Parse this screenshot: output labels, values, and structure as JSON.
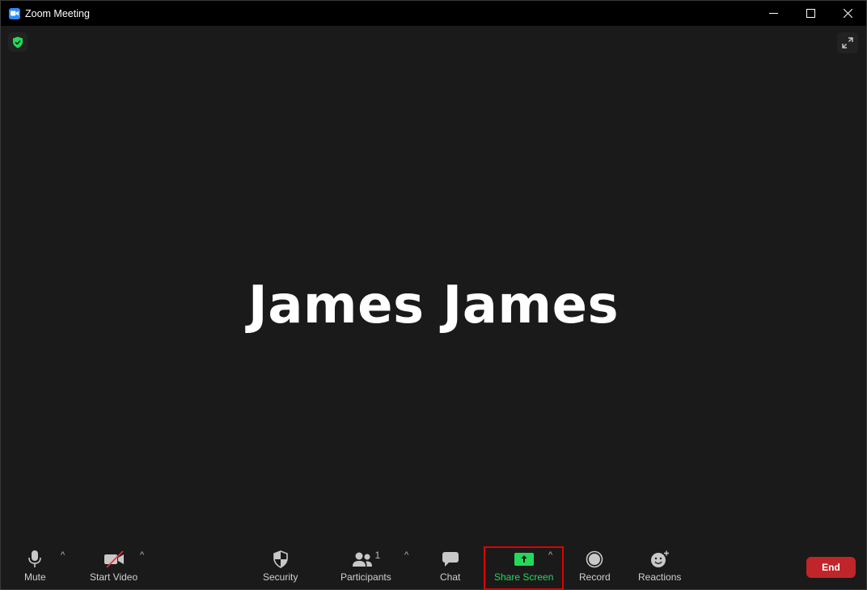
{
  "window": {
    "title": "Zoom Meeting",
    "app_icon": "zoom-camera-icon",
    "controls": [
      "minimize-icon",
      "maximize-icon",
      "close-icon"
    ]
  },
  "meeting": {
    "participant_name": "James James",
    "encryption_icon": "shield-check-icon",
    "fullscreen_icon": "expand-icon"
  },
  "toolbar": {
    "mute_label": "Mute",
    "video_label": "Start Video",
    "security_label": "Security",
    "participants_label": "Participants",
    "participants_count": "1",
    "chat_label": "Chat",
    "share_label": "Share Screen",
    "record_label": "Record",
    "reactions_label": "Reactions",
    "end_label": "End",
    "caret": "^"
  },
  "colors": {
    "accent_green": "#23d959",
    "end_red": "#c0252a",
    "highlight_red": "#e00000"
  }
}
